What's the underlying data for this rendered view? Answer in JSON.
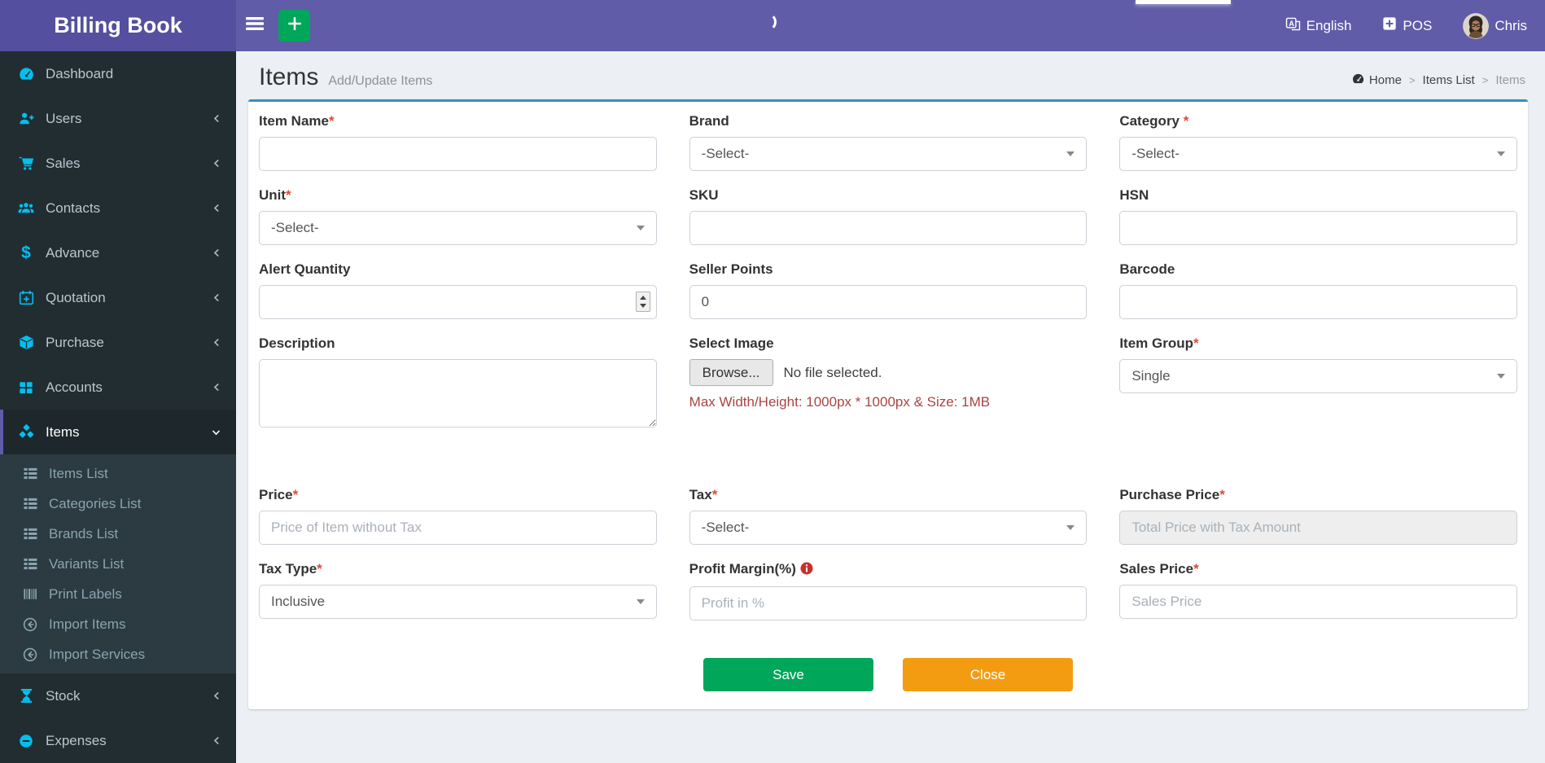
{
  "app": {
    "title": "Billing Book"
  },
  "navbar": {
    "language_label": "English",
    "pos_label": "POS",
    "user_name": "Chris"
  },
  "sidebar": {
    "items": [
      {
        "label": "Dashboard",
        "icon": "dashboard"
      },
      {
        "label": "Users",
        "icon": "user-plus"
      },
      {
        "label": "Sales",
        "icon": "cart"
      },
      {
        "label": "Contacts",
        "icon": "users"
      },
      {
        "label": "Advance",
        "icon": "dollar"
      },
      {
        "label": "Quotation",
        "icon": "calendar-plus"
      },
      {
        "label": "Purchase",
        "icon": "cube"
      },
      {
        "label": "Accounts",
        "icon": "grid"
      },
      {
        "label": "Items",
        "icon": "cubes",
        "active": true
      },
      {
        "label": "Stock",
        "icon": "hourglass"
      },
      {
        "label": "Expenses",
        "icon": "minus-circle"
      }
    ],
    "sub_items": [
      {
        "label": "Items List",
        "icon": "list"
      },
      {
        "label": "Categories List",
        "icon": "list"
      },
      {
        "label": "Brands List",
        "icon": "list"
      },
      {
        "label": "Variants List",
        "icon": "list"
      },
      {
        "label": "Print Labels",
        "icon": "barcode"
      },
      {
        "label": "Import Items",
        "icon": "import"
      },
      {
        "label": "Import Services",
        "icon": "import"
      }
    ]
  },
  "content": {
    "page_title": "Items",
    "page_subtitle": "Add/Update Items",
    "breadcrumb": {
      "items": [
        {
          "label": "Home"
        },
        {
          "label": "Items List"
        },
        {
          "label": "Items"
        }
      ],
      "separator": ">"
    },
    "form": {
      "fields": {
        "item_name": {
          "label": "Item Name",
          "marker": "*"
        },
        "brand": {
          "label": "Brand",
          "value": "-Select-"
        },
        "category": {
          "label": "Category",
          "marker": " *",
          "value": "-Select-"
        },
        "unit": {
          "label": "Unit",
          "marker": "*",
          "value": "-Select-"
        },
        "sku": {
          "label": "SKU"
        },
        "hsn": {
          "label": "HSN"
        },
        "alert_quantity": {
          "label": "Alert Quantity"
        },
        "seller_points": {
          "label": "Seller Points",
          "value": "0"
        },
        "barcode": {
          "label": "Barcode"
        },
        "description": {
          "label": "Description"
        },
        "select_image": {
          "label": "Select Image",
          "browse_label": "Browse...",
          "no_file_text": "No file selected.",
          "note": "Max Width/Height: 1000px * 1000px & Size: 1MB"
        },
        "item_group": {
          "label": "Item Group",
          "marker": "*",
          "value": "Single"
        },
        "price": {
          "label": "Price",
          "marker": "*",
          "placeholder": "Price of Item without Tax"
        },
        "tax": {
          "label": "Tax",
          "marker": "*",
          "value": "-Select-"
        },
        "purchase_price": {
          "label": "Purchase Price",
          "marker": "*",
          "placeholder": "Total Price with Tax Amount"
        },
        "tax_type": {
          "label": "Tax Type",
          "marker": "*",
          "value": "Inclusive"
        },
        "profit_margin": {
          "label": "Profit Margin(%)",
          "placeholder": "Profit in %"
        },
        "sales_price": {
          "label": "Sales Price",
          "marker": "*",
          "placeholder": "Sales Price"
        }
      },
      "buttons": {
        "save": "Save",
        "close": "Close"
      }
    }
  },
  "colors": {
    "navbar_purple": "#605ca8",
    "logo_purple": "#544f9e",
    "sidebar_bg": "#222d32",
    "submenu_bg": "#2c3b41",
    "sidebar_icon_cyan": "#00c0ef",
    "active_border_purple": "#605ca8",
    "card_accent_blue": "#3c8dbc",
    "save_green": "#00a65a",
    "close_orange": "#f39c12",
    "required_red": "#dd4b39",
    "note_red": "#a94442",
    "content_bg": "#ecf0f5"
  }
}
